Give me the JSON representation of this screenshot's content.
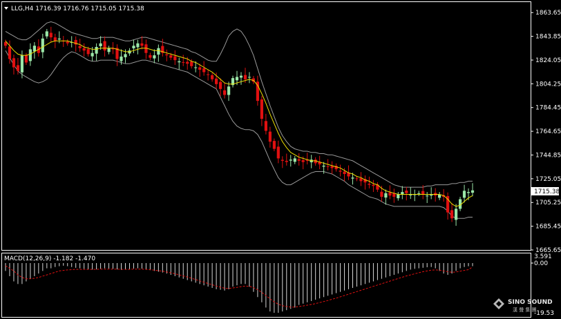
{
  "header": {
    "symbol_text": "LLG,H4  1716.39 1716.76 1715.05 1715.38"
  },
  "macd": {
    "label": "MACD(12,26,9) -1.182 -1.470",
    "axis_top": "3.591",
    "axis_mid": "0.00",
    "axis_bottom": "-19.53"
  },
  "logo": {
    "brand": "SINO SOUND",
    "sub": "漢 聲 集 團"
  },
  "colors": {
    "bull": "#9be7a8",
    "bear": "#e01010",
    "band": "#9a9a9a",
    "ma": "#f0e000",
    "signal": "#e01010",
    "hist": "#d8d8d8",
    "grid": "#ffffff"
  },
  "chart_data": {
    "type": "candlestick",
    "price_axis": [
      "1863.65",
      "1843.85",
      "1824.05",
      "1804.25",
      "1784.45",
      "1764.65",
      "1744.85",
      "1725.05",
      "1705.25",
      "1685.45",
      "1665.65"
    ],
    "ylim": [
      1665.65,
      1873
    ],
    "last_price": "1715.38",
    "close": [
      1836,
      1825,
      1818,
      1815,
      1828,
      1822,
      1833,
      1836,
      1830,
      1842,
      1848,
      1843,
      1840,
      1842,
      1840,
      1838,
      1839,
      1837,
      1834,
      1832,
      1829,
      1830,
      1835,
      1838,
      1832,
      1834,
      1833,
      1825,
      1827,
      1829,
      1832,
      1836,
      1838,
      1836,
      1830,
      1826,
      1828,
      1834,
      1830,
      1828,
      1826,
      1824,
      1823,
      1822,
      1821,
      1819,
      1818,
      1816,
      1814,
      1812,
      1808,
      1804,
      1800,
      1795,
      1802,
      1809,
      1810,
      1811,
      1808,
      1810,
      1806,
      1790,
      1775,
      1765,
      1756,
      1750,
      1742,
      1740,
      1739,
      1741,
      1742,
      1740,
      1739,
      1740,
      1741,
      1738,
      1737,
      1736,
      1735,
      1734,
      1733,
      1731,
      1729,
      1727,
      1726,
      1725,
      1723,
      1722,
      1720,
      1719,
      1716,
      1710,
      1713,
      1711,
      1710,
      1712,
      1714,
      1713,
      1712,
      1712,
      1713,
      1712,
      1711,
      1712,
      1711,
      1712,
      1710,
      1697,
      1692,
      1700,
      1708,
      1715,
      1714,
      1715.38
    ],
    "ma": [
      1840,
      1836,
      1832,
      1829,
      1828,
      1828,
      1829,
      1831,
      1833,
      1835,
      1837,
      1839,
      1840,
      1840,
      1840,
      1840,
      1839,
      1838,
      1837,
      1835,
      1834,
      1833,
      1833,
      1834,
      1834,
      1834,
      1834,
      1833,
      1832,
      1831,
      1831,
      1832,
      1833,
      1834,
      1834,
      1833,
      1832,
      1832,
      1831,
      1830,
      1829,
      1828,
      1827,
      1826,
      1825,
      1823,
      1822,
      1820,
      1818,
      1816,
      1814,
      1811,
      1808,
      1805,
      1804,
      1804,
      1805,
      1806,
      1807,
      1808,
      1807,
      1803,
      1796,
      1788,
      1779,
      1771,
      1763,
      1756,
      1751,
      1747,
      1745,
      1743,
      1742,
      1741,
      1740,
      1740,
      1739,
      1738,
      1737,
      1736,
      1735,
      1734,
      1732,
      1730,
      1729,
      1727,
      1726,
      1724,
      1723,
      1721,
      1720,
      1717,
      1715,
      1714,
      1713,
      1712,
      1712,
      1712,
      1712,
      1712,
      1712,
      1712,
      1712,
      1712,
      1712,
      1712,
      1711,
      1708,
      1704,
      1702,
      1703,
      1706,
      1709,
      1711
    ],
    "band_upper": [
      1848,
      1846,
      1844,
      1842,
      1841,
      1841,
      1843,
      1846,
      1849,
      1852,
      1855,
      1856,
      1855,
      1853,
      1851,
      1849,
      1847,
      1846,
      1845,
      1844,
      1843,
      1842,
      1842,
      1843,
      1843,
      1843,
      1843,
      1842,
      1841,
      1840,
      1840,
      1841,
      1842,
      1843,
      1843,
      1842,
      1841,
      1840,
      1839,
      1838,
      1837,
      1836,
      1835,
      1834,
      1833,
      1831,
      1830,
      1828,
      1826,
      1824,
      1823,
      1823,
      1829,
      1836,
      1844,
      1848,
      1850,
      1848,
      1843,
      1836,
      1828,
      1817,
      1806,
      1796,
      1786,
      1777,
      1768,
      1761,
      1756,
      1752,
      1750,
      1749,
      1748,
      1748,
      1747,
      1747,
      1746,
      1746,
      1745,
      1745,
      1744,
      1743,
      1742,
      1741,
      1740,
      1738,
      1736,
      1734,
      1732,
      1730,
      1728,
      1726,
      1724,
      1722,
      1720,
      1719,
      1718,
      1718,
      1718,
      1718,
      1718,
      1718,
      1719,
      1719,
      1720,
      1720,
      1720,
      1720,
      1721,
      1721,
      1722,
      1722,
      1723,
      1723
    ],
    "band_lower": [
      1832,
      1826,
      1820,
      1815,
      1812,
      1810,
      1808,
      1806,
      1805,
      1806,
      1808,
      1812,
      1817,
      1822,
      1826,
      1829,
      1831,
      1830,
      1828,
      1826,
      1824,
      1823,
      1823,
      1824,
      1824,
      1824,
      1824,
      1823,
      1822,
      1821,
      1821,
      1822,
      1823,
      1824,
      1824,
      1823,
      1822,
      1821,
      1820,
      1819,
      1818,
      1817,
      1816,
      1815,
      1814,
      1812,
      1810,
      1808,
      1806,
      1804,
      1802,
      1800,
      1793,
      1786,
      1779,
      1773,
      1769,
      1767,
      1766,
      1766,
      1765,
      1762,
      1756,
      1748,
      1740,
      1733,
      1726,
      1722,
      1720,
      1720,
      1722,
      1724,
      1726,
      1728,
      1730,
      1731,
      1731,
      1731,
      1730,
      1729,
      1727,
      1725,
      1723,
      1720,
      1718,
      1716,
      1714,
      1712,
      1710,
      1709,
      1708,
      1706,
      1704,
      1703,
      1702,
      1702,
      1702,
      1702,
      1702,
      1702,
      1702,
      1702,
      1702,
      1702,
      1702,
      1702,
      1701,
      1698,
      1694,
      1692,
      1692,
      1692,
      1693,
      1693
    ],
    "macd_hist": [
      -3,
      -5,
      -7,
      -8,
      -8,
      -7,
      -6,
      -5,
      -4,
      -3,
      -2,
      -2,
      -1.5,
      -1.2,
      -1,
      -1.2,
      -1.5,
      -1.8,
      -2,
      -2.2,
      -2.4,
      -2.5,
      -2.4,
      -2.2,
      -2,
      -2.1,
      -2.2,
      -2.4,
      -2.6,
      -2.5,
      -2.3,
      -2.1,
      -2,
      -2.1,
      -2.4,
      -2.7,
      -3,
      -3.3,
      -3.6,
      -4,
      -4.5,
      -5,
      -5.5,
      -6,
      -6.5,
      -7,
      -7.5,
      -8,
      -8.5,
      -9,
      -9.5,
      -10,
      -10.2,
      -10.5,
      -10,
      -9,
      -8.5,
      -8,
      -8,
      -9,
      -11,
      -13,
      -15,
      -17,
      -18.5,
      -19,
      -19,
      -18.5,
      -18,
      -17.5,
      -17,
      -16,
      -15.5,
      -15,
      -14.5,
      -14,
      -13.5,
      -13,
      -12.5,
      -12,
      -11.5,
      -11,
      -10.5,
      -10,
      -9.5,
      -9,
      -8.5,
      -8,
      -7.5,
      -7,
      -6.5,
      -6,
      -5.5,
      -5,
      -4.5,
      -4,
      -3.5,
      -3,
      -2.5,
      -2.2,
      -2,
      -1.8,
      -1.6,
      -1.5,
      -2,
      -3,
      -4,
      -4.5,
      -4,
      -3,
      -2,
      -1.5,
      -1.2,
      -1.182
    ],
    "macd_signal": [
      -1,
      -2,
      -3,
      -4.5,
      -5.5,
      -6,
      -6,
      -5.8,
      -5.5,
      -5,
      -4.5,
      -4,
      -3.5,
      -3,
      -2.8,
      -2.6,
      -2.5,
      -2.4,
      -2.4,
      -2.4,
      -2.4,
      -2.4,
      -2.4,
      -2.3,
      -2.3,
      -2.3,
      -2.3,
      -2.3,
      -2.4,
      -2.4,
      -2.4,
      -2.3,
      -2.3,
      -2.3,
      -2.4,
      -2.5,
      -2.7,
      -2.9,
      -3.1,
      -3.4,
      -3.7,
      -4.1,
      -4.5,
      -4.9,
      -5.3,
      -5.8,
      -6.3,
      -6.8,
      -7.3,
      -7.8,
      -8.3,
      -8.8,
      -9.2,
      -9.6,
      -9.7,
      -9.5,
      -9.3,
      -9,
      -8.8,
      -8.9,
      -9.4,
      -10.2,
      -11.2,
      -12.4,
      -13.7,
      -14.8,
      -15.7,
      -16.3,
      -16.6,
      -16.8,
      -16.8,
      -16.6,
      -16.4,
      -16.1,
      -15.8,
      -15.5,
      -15.1,
      -14.7,
      -14.3,
      -13.8,
      -13.4,
      -12.9,
      -12.4,
      -11.9,
      -11.4,
      -10.9,
      -10.4,
      -9.9,
      -9.4,
      -8.9,
      -8.4,
      -7.9,
      -7.4,
      -6.9,
      -6.4,
      -5.9,
      -5.4,
      -4.9,
      -4.5,
      -4.1,
      -3.7,
      -3.3,
      -3,
      -2.7,
      -2.6,
      -2.7,
      -3,
      -3.3,
      -3.5,
      -3.4,
      -3.1,
      -2.8,
      -2.5,
      -1.47
    ]
  }
}
